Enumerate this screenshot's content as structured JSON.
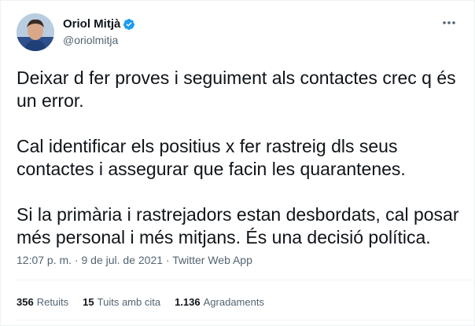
{
  "author": {
    "name": "Oriol Mitjà",
    "handle": "@oriolmitja",
    "verified_badge_color": "#1d9bf0"
  },
  "tweet": {
    "paragraphs": [
      "Deixar d fer proves i seguiment als contactes crec q és\nun error.",
      "Cal identificar els positius x fer rastreig dls seus\ncontactes i assegurar que facin les quarantenes.",
      "Si la primària i rastrejadors estan desbordats, cal posar\nmés personal i més mitjans. És una decisió política."
    ],
    "meta": "12:07 p. m. · 9 de jul. de 2021 · Twitter Web App"
  },
  "stats": {
    "retweets_count": "356",
    "retweets_label": "Retuits",
    "quotes_count": "15",
    "quotes_label": "Tuits amb cita",
    "likes_count": "1.136",
    "likes_label": "Agradaments"
  },
  "icons": {
    "more": "more-horizontal-icon",
    "verified": "verified-badge-icon"
  }
}
